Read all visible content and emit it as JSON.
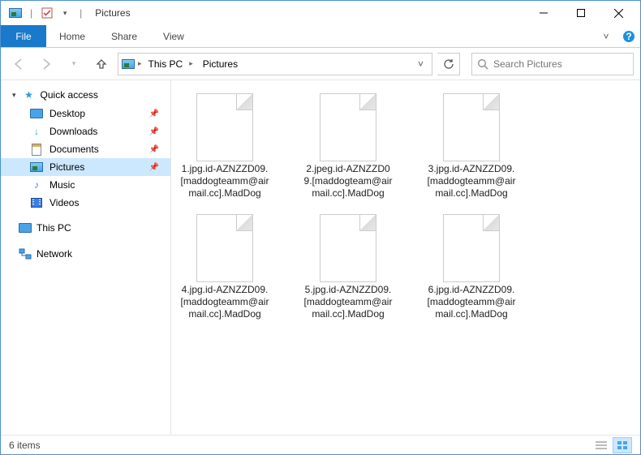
{
  "window": {
    "title": "Pictures"
  },
  "ribbon": {
    "file": "File",
    "tabs": [
      "Home",
      "Share",
      "View"
    ]
  },
  "breadcrumb": {
    "items": [
      "This PC",
      "Pictures"
    ]
  },
  "search": {
    "placeholder": "Search Pictures"
  },
  "sidebar": {
    "quick_access": {
      "label": "Quick access",
      "items": [
        {
          "label": "Desktop",
          "icon": "desktop",
          "pinned": true
        },
        {
          "label": "Downloads",
          "icon": "downloads",
          "pinned": true
        },
        {
          "label": "Documents",
          "icon": "documents",
          "pinned": true
        },
        {
          "label": "Pictures",
          "icon": "pictures",
          "pinned": true,
          "selected": true
        },
        {
          "label": "Music",
          "icon": "music",
          "pinned": false
        },
        {
          "label": "Videos",
          "icon": "videos",
          "pinned": false
        }
      ]
    },
    "this_pc": {
      "label": "This PC"
    },
    "network": {
      "label": "Network"
    }
  },
  "files": [
    {
      "name": "1.jpg.id-AZNZZD09.[maddogteamm@airmail.cc].MadDog"
    },
    {
      "name": "2.jpeg.id-AZNZZD09.[maddogteam@airmail.cc].MadDog"
    },
    {
      "name": "3.jpg.id-AZNZZD09.[maddogteamm@airmail.cc].MadDog"
    },
    {
      "name": "4.jpg.id-AZNZZD09.[maddogteamm@airmail.cc].MadDog"
    },
    {
      "name": "5.jpg.id-AZNZZD09.[maddogteamm@airmail.cc].MadDog"
    },
    {
      "name": "6.jpg.id-AZNZZD09.[maddogteamm@airmail.cc].MadDog"
    }
  ],
  "status": {
    "count_label": "6 items"
  }
}
